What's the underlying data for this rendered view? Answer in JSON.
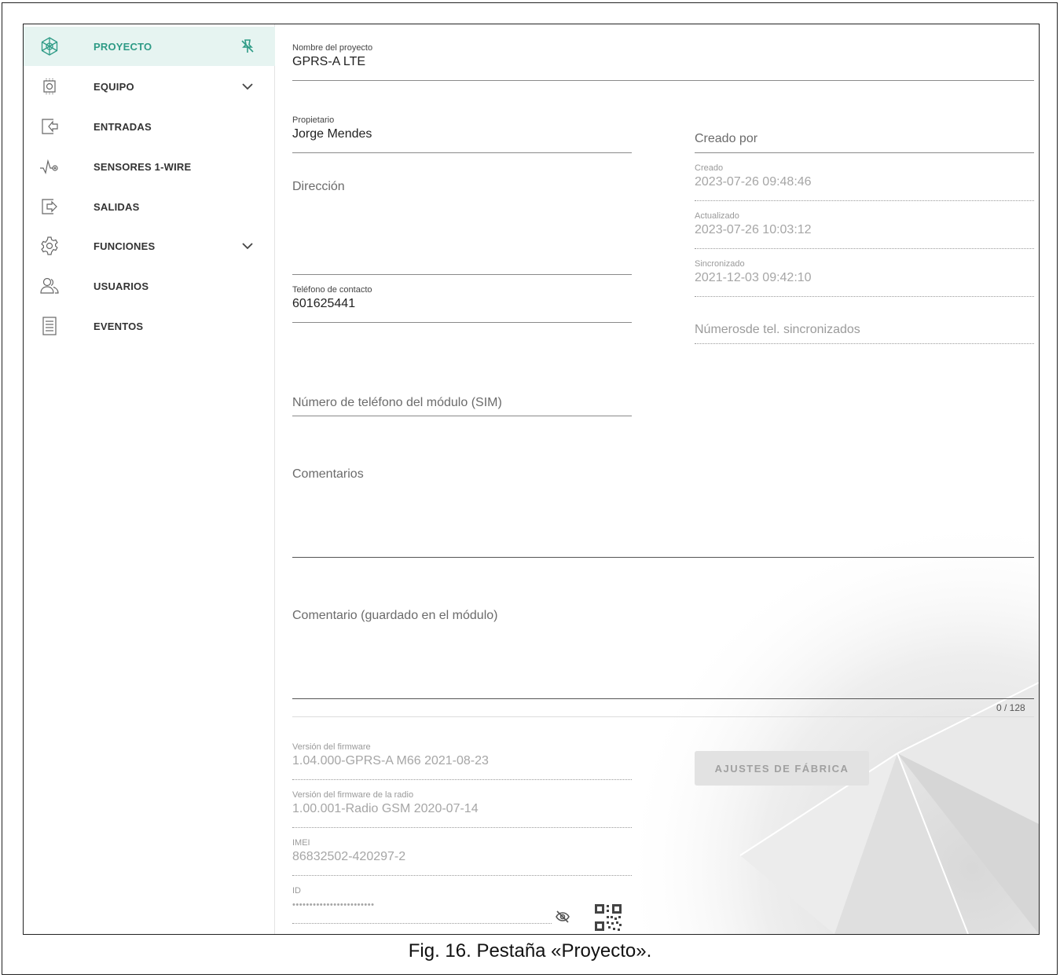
{
  "sidebar": {
    "items": [
      {
        "label": "PROYECTO",
        "icon": "project-icon",
        "active": true,
        "right_icon": "pin-off-icon"
      },
      {
        "label": "EQUIPO",
        "icon": "chip-icon",
        "right_icon": "chevron-down-icon"
      },
      {
        "label": "ENTRADAS",
        "icon": "input-icon"
      },
      {
        "label": "SENSORES 1-WIRE",
        "icon": "sensor-pulse-icon"
      },
      {
        "label": "SALIDAS",
        "icon": "output-icon"
      },
      {
        "label": "FUNCIONES",
        "icon": "gear-icon",
        "right_icon": "chevron-down-icon"
      },
      {
        "label": "USUARIOS",
        "icon": "users-icon"
      },
      {
        "label": "EVENTOS",
        "icon": "document-list-icon"
      }
    ]
  },
  "form": {
    "project_name": {
      "label": "Nombre del proyecto",
      "value": "GPRS-A LTE"
    },
    "owner": {
      "label": "Propietario",
      "value": "Jorge Mendes"
    },
    "created_by": {
      "placeholder": "Creado por"
    },
    "address": {
      "placeholder": "Dirección"
    },
    "created": {
      "label": "Creado",
      "value": "2023-07-26 09:48:46"
    },
    "updated": {
      "label": "Actualizado",
      "value": "2023-07-26 10:03:12"
    },
    "synced": {
      "label": "Sincronizado",
      "value": "2021-12-03 09:42:10"
    },
    "contact_phone": {
      "label": "Teléfono de contacto",
      "value": "601625441"
    },
    "synced_numbers": {
      "placeholder": "Númerosde tel. sincronizados"
    },
    "sim_number": {
      "placeholder": "Número de teléfono del módulo (SIM)"
    },
    "comments": {
      "placeholder": "Comentarios"
    },
    "module_comment": {
      "placeholder": "Comentario (guardado en el módulo)",
      "counter": "0 / 128"
    },
    "firmware": {
      "label": "Versión del firmware",
      "value": "1.04.000-GPRS-A M66 2021-08-23"
    },
    "radio_firmware": {
      "label": "Versión del firmware de la radio",
      "value": "1.00.001-Radio GSM 2020-07-14"
    },
    "imei": {
      "label": "IMEI",
      "value": "86832502-420297-2"
    },
    "id": {
      "label": "ID",
      "value": "••••••••••••••••••••••••"
    },
    "factory_button": "AJUSTES DE FÁBRICA"
  },
  "caption": "Fig. 16. Pestaña «Proyecto».",
  "colors": {
    "accent": "#2e9b86",
    "active_bg": "#e6f4f1"
  }
}
